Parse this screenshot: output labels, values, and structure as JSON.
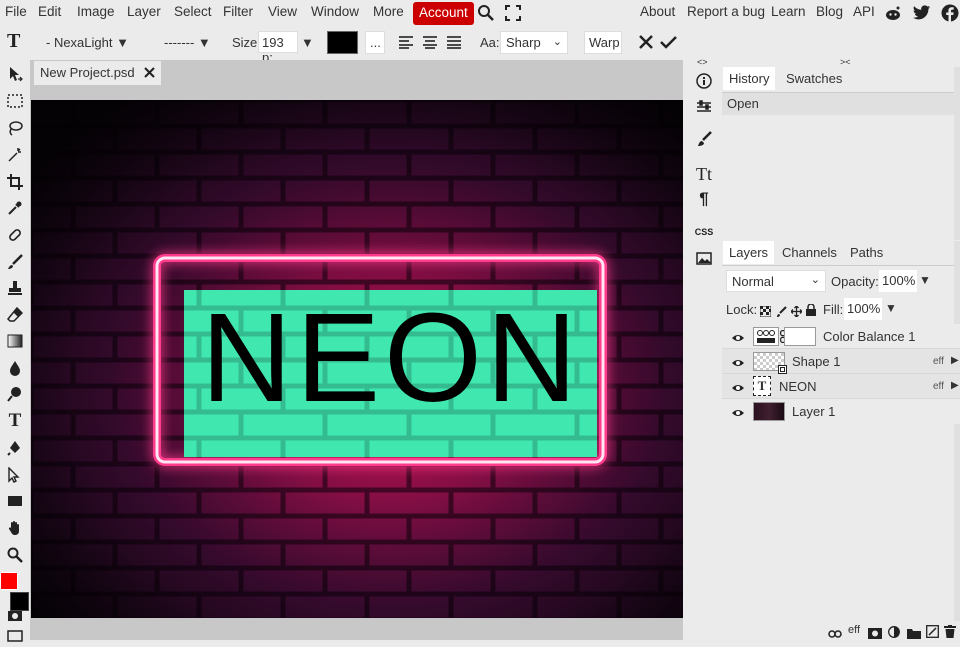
{
  "menu": [
    "File",
    "Edit",
    "Image",
    "Layer",
    "Select",
    "Filter",
    "View",
    "Window",
    "More"
  ],
  "account": "Account",
  "menu_right": [
    "About",
    "Report a bug",
    "Learn",
    "Blog",
    "API"
  ],
  "options": {
    "font": "- NexaLight ▼",
    "style": "------- ▼",
    "size_label": "Size:",
    "size_value": "193 p:",
    "more": "...",
    "aa_label": "Aa:",
    "aa_value": "Sharp",
    "warp": "Warp"
  },
  "doc_tab": "New Project.psd",
  "canvas_text": "NEON",
  "mini": {
    "css": "CSS"
  },
  "history": {
    "tabs": [
      "History",
      "Swatches"
    ],
    "items": [
      "Open"
    ]
  },
  "layers_panel": {
    "tabs": [
      "Layers",
      "Channels",
      "Paths"
    ],
    "blend_mode": "Normal",
    "opacity_label": "Opacity:",
    "opacity_value": "100%",
    "lock_label": "Lock:",
    "fill_label": "Fill:",
    "fill_value": "100%",
    "eff": "eff",
    "layers": [
      {
        "name": "Color Balance 1"
      },
      {
        "name": "Shape 1"
      },
      {
        "name": "NEON"
      },
      {
        "name": "Layer 1"
      }
    ]
  },
  "bottom_eff": "eff",
  "colors": {
    "accent": "#cc0000",
    "foreground": "#ff0000",
    "background": "#000000",
    "neon_fill": "#40e8b0"
  }
}
